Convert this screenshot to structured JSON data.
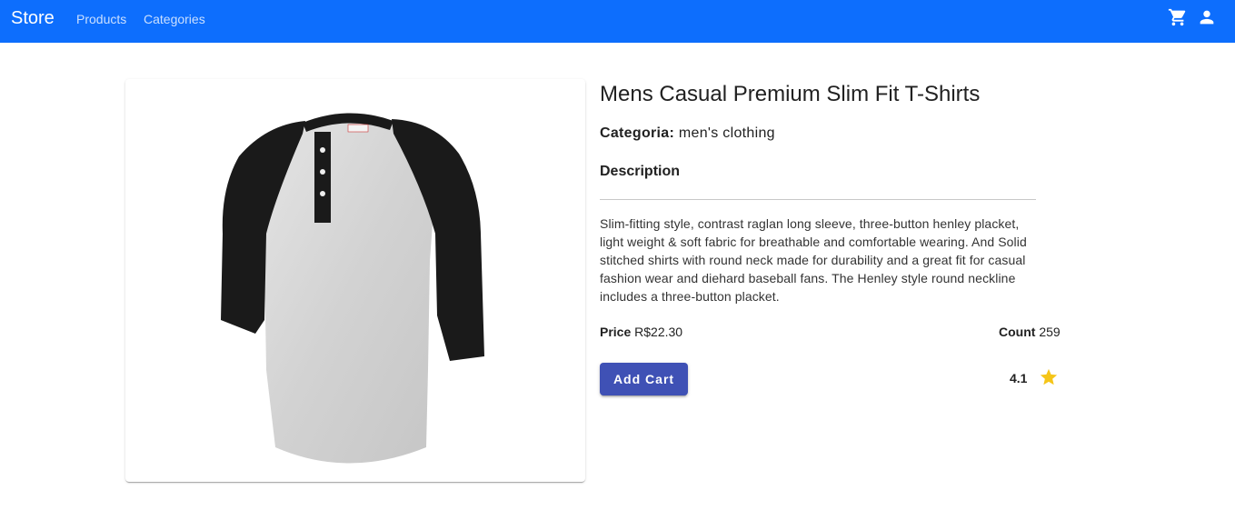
{
  "appbar": {
    "brand": "Store",
    "nav": [
      {
        "label": "Products"
      },
      {
        "label": "Categories"
      }
    ],
    "icons": [
      "shopping-cart-icon",
      "account-icon"
    ],
    "background": "#0d6efd"
  },
  "product": {
    "image_icon": "tshirt-image",
    "title": "Mens Casual Premium Slim Fit T-Shirts",
    "category_label": "Categoria:",
    "category_value": "men's clothing",
    "description_heading": "Description",
    "description": "Slim-fitting style, contrast raglan long sleeve, three-button henley placket, light weight & soft fabric for breathable and comfortable wearing. And Solid stitched shirts with round neck made for durability and a great fit for casual fashion wear and diehard baseball fans. The Henley style round neckline includes a three-button placket.",
    "price_label": "Price",
    "price_value": "R$22.30",
    "count_label": "Count",
    "count_value": "259",
    "add_cart_label": "Add Cart",
    "rating_value": "4.1",
    "rating_icon": "star-icon",
    "button_color": "#3f51b5",
    "star_color": "#f5c518"
  }
}
